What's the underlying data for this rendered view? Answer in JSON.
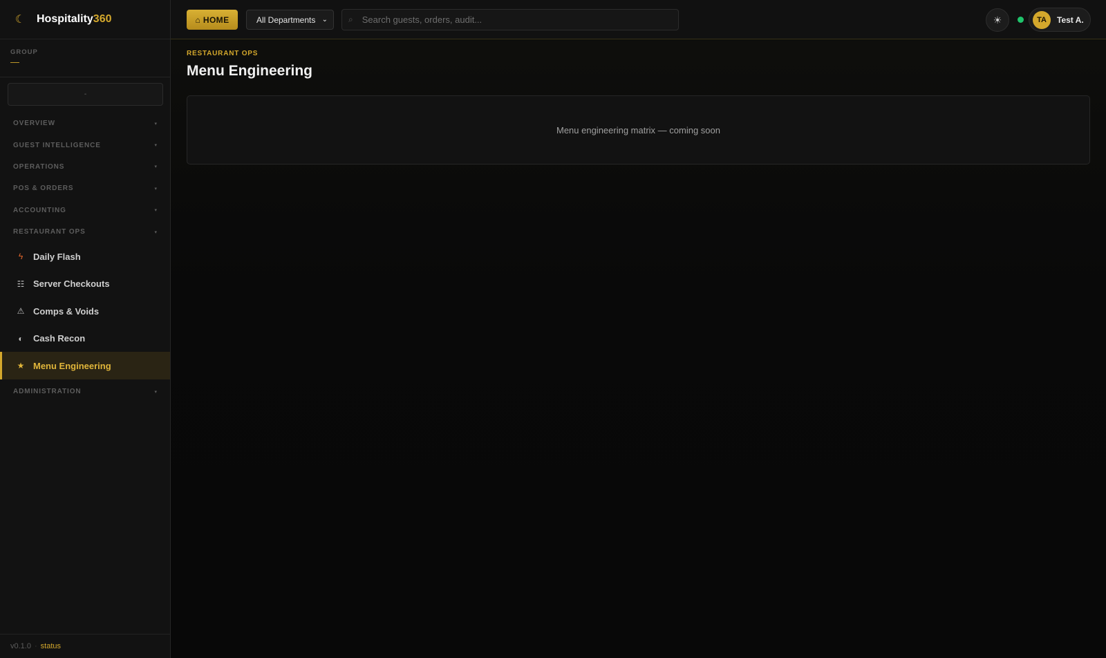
{
  "brand": {
    "name": "Hospitality",
    "accent": "360",
    "logo_icon": "moon-logo-icon"
  },
  "group": {
    "label": "GROUP",
    "value": "—"
  },
  "property_select": {
    "value": "-"
  },
  "sidebar": {
    "sections": [
      {
        "label": "OVERVIEW"
      },
      {
        "label": "GUEST INTELLIGENCE"
      },
      {
        "label": "OPERATIONS"
      },
      {
        "label": "POS & ORDERS"
      },
      {
        "label": "ACCOUNTING"
      },
      {
        "label": "RESTAURANT OPS"
      },
      {
        "label": "ADMINISTRATION"
      }
    ],
    "items": [
      {
        "label": "Daily Flash",
        "icon": "lightning-icon"
      },
      {
        "label": "Server Checkouts",
        "icon": "list-icon"
      },
      {
        "label": "Comps & Voids",
        "icon": "warning-icon"
      },
      {
        "label": "Cash Recon",
        "icon": "half-circle-icon"
      },
      {
        "label": "Menu Engineering",
        "icon": "star-icon",
        "active": true
      }
    ],
    "footer": {
      "version": "v0.1.0",
      "separator": "·",
      "status": "status"
    }
  },
  "topbar": {
    "home_label": "⌂ HOME",
    "department": "All Departments",
    "search_placeholder": "Search guests, orders, audit...",
    "user_initials": "TA",
    "user_name": "Test A."
  },
  "main": {
    "breadcrumb": "RESTAURANT OPS",
    "title": "Menu Engineering",
    "placeholder_text": "Menu engineering matrix — coming soon"
  },
  "colors": {
    "accent": "#d4a82c",
    "online": "#1fc46b",
    "background": "#0b0b0b"
  }
}
